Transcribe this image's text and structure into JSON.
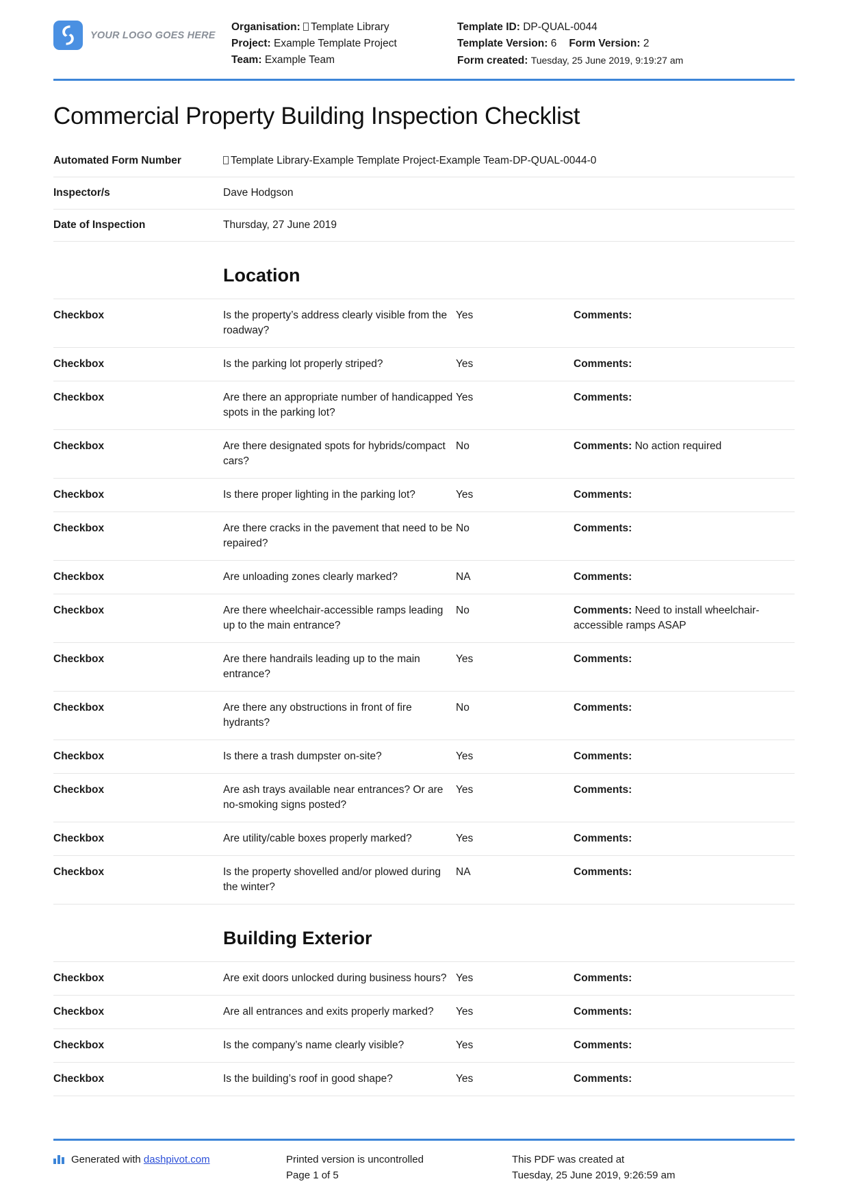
{
  "header": {
    "logo_text": "YOUR LOGO GOES HERE",
    "organisation_label": "Organisation:",
    "organisation_value": "Template Library",
    "project_label": "Project:",
    "project_value": "Example Template Project",
    "team_label": "Team:",
    "team_value": "Example Team",
    "template_id_label": "Template ID:",
    "template_id_value": "DP-QUAL-0044",
    "template_version_label": "Template Version:",
    "template_version_value": "6",
    "form_version_label": "Form Version:",
    "form_version_value": "2",
    "form_created_label": "Form created:",
    "form_created_value": "Tuesday, 25 June 2019, 9:19:27 am"
  },
  "title": "Commercial Property Building Inspection Checklist",
  "info_rows": [
    {
      "label": "Automated Form Number",
      "value": "Template Library-Example Template Project-Example Team-DP-QUAL-0044-0",
      "has_box_glyph": true
    },
    {
      "label": "Inspector/s",
      "value": "Dave Hodgson",
      "has_box_glyph": false
    },
    {
      "label": "Date of Inspection",
      "value": "Thursday, 27 June 2019",
      "has_box_glyph": false
    }
  ],
  "comments_label": "Comments:",
  "sections": [
    {
      "heading": "Location",
      "rows": [
        {
          "type": "Checkbox",
          "question": "Is the property’s address clearly visible from the roadway?",
          "answer": "Yes",
          "comment": ""
        },
        {
          "type": "Checkbox",
          "question": "Is the parking lot properly striped?",
          "answer": "Yes",
          "comment": ""
        },
        {
          "type": "Checkbox",
          "question": "Are there an appropriate number of handicapped spots in the parking lot?",
          "answer": "Yes",
          "comment": ""
        },
        {
          "type": "Checkbox",
          "question": "Are there designated spots for hybrids/compact cars?",
          "answer": "No",
          "comment": "No action required"
        },
        {
          "type": "Checkbox",
          "question": "Is there proper lighting in the parking lot?",
          "answer": "Yes",
          "comment": ""
        },
        {
          "type": "Checkbox",
          "question": "Are there cracks in the pavement that need to be repaired?",
          "answer": "No",
          "comment": ""
        },
        {
          "type": "Checkbox",
          "question": "Are unloading zones clearly marked?",
          "answer": "NA",
          "comment": ""
        },
        {
          "type": "Checkbox",
          "question": "Are there wheelchair-accessible ramps leading up to the main entrance?",
          "answer": "No",
          "comment": "Need to install wheelchair-accessible ramps ASAP"
        },
        {
          "type": "Checkbox",
          "question": "Are there handrails leading up to the main entrance?",
          "answer": "Yes",
          "comment": ""
        },
        {
          "type": "Checkbox",
          "question": "Are there any obstructions in front of fire hydrants?",
          "answer": "No",
          "comment": ""
        },
        {
          "type": "Checkbox",
          "question": "Is there a trash dumpster on-site?",
          "answer": "Yes",
          "comment": ""
        },
        {
          "type": "Checkbox",
          "question": "Are ash trays available near entrances? Or are no-smoking signs posted?",
          "answer": "Yes",
          "comment": ""
        },
        {
          "type": "Checkbox",
          "question": "Are utility/cable boxes properly marked?",
          "answer": "Yes",
          "comment": ""
        },
        {
          "type": "Checkbox",
          "question": "Is the property shovelled and/or plowed during the winter?",
          "answer": "NA",
          "comment": ""
        }
      ]
    },
    {
      "heading": "Building Exterior",
      "rows": [
        {
          "type": "Checkbox",
          "question": "Are exit doors unlocked during business hours?",
          "answer": "Yes",
          "comment": ""
        },
        {
          "type": "Checkbox",
          "question": "Are all entrances and exits properly marked?",
          "answer": "Yes",
          "comment": ""
        },
        {
          "type": "Checkbox",
          "question": "Is the company’s name clearly visible?",
          "answer": "Yes",
          "comment": ""
        },
        {
          "type": "Checkbox",
          "question": "Is the building’s roof in good shape?",
          "answer": "Yes",
          "comment": ""
        }
      ]
    }
  ],
  "footer": {
    "generated_prefix": "Generated with",
    "generated_link": "dashpivot.com",
    "printed_line1": "Printed version is uncontrolled",
    "printed_line2": "Page 1 of 5",
    "created_line1": "This PDF was created at",
    "created_line2": "Tuesday, 25 June 2019, 9:26:59 am"
  }
}
